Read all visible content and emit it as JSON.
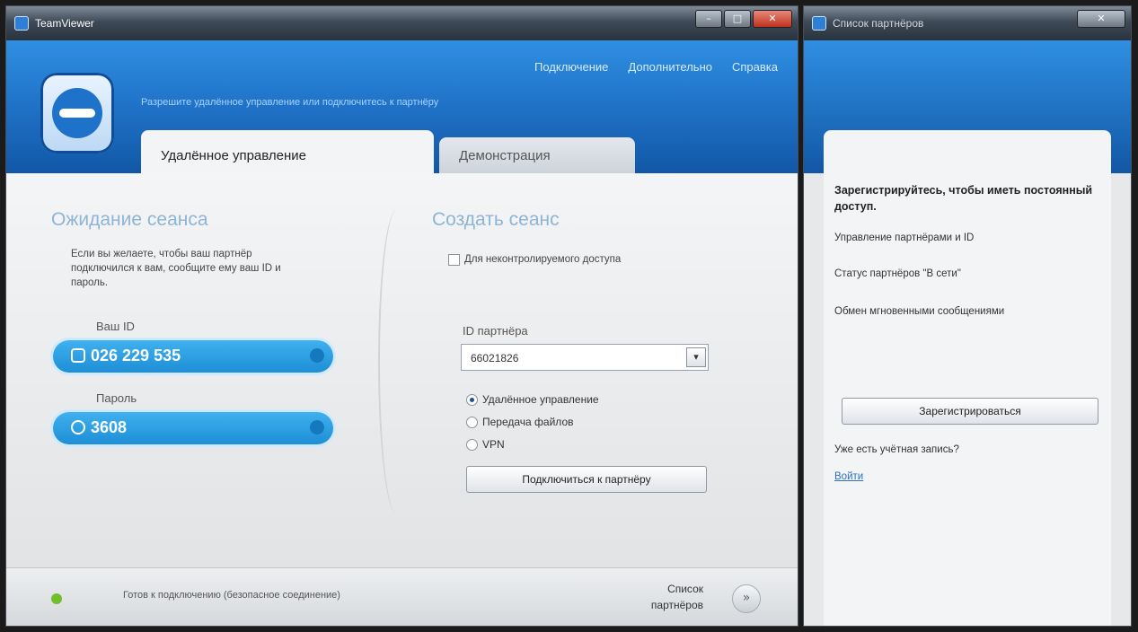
{
  "main_window": {
    "title": "TeamViewer",
    "nav": [
      "Подключение",
      "Дополнительно",
      "Справка"
    ],
    "tagline": "Разрешите удалённое управление или подключитесь к партнёру",
    "tabs": [
      "Удалённое управление",
      "Демонстрация"
    ],
    "left": {
      "title": "Ожидание сеанса",
      "description": "Если вы желаете, чтобы ваш партнёр подключился к вам, сообщите ему ваш ID и пароль.",
      "id_label": "Ваш ID",
      "id_value": "026 229 535",
      "password_label": "Пароль",
      "password_value": "3608"
    },
    "right": {
      "title": "Создать сеанс",
      "checkbox_label": "Для неконтролируемого доступа",
      "partner_id_label": "ID партнёра",
      "partner_id_value": "66021826",
      "radio_options": [
        "Удалённое управление",
        "Передача файлов",
        "VPN"
      ],
      "selected_radio": 0,
      "connect_button": "Подключиться к партнёру"
    },
    "status": {
      "text": "Готов к подключению (безопасное соединение)",
      "partners_label": "Список партнёров"
    }
  },
  "side_window": {
    "title": "Список партнёров",
    "heading": "Зарегистрируйтесь, чтобы иметь постоянный доступ.",
    "lines": [
      "Управление партнёрами и ID",
      "Статус партнёров \"В сети\"",
      "Обмен мгновенными сообщениями"
    ],
    "signup_button": "Зарегистрироваться",
    "question": "Уже есть учётная запись?",
    "signin_link": "Войти"
  }
}
